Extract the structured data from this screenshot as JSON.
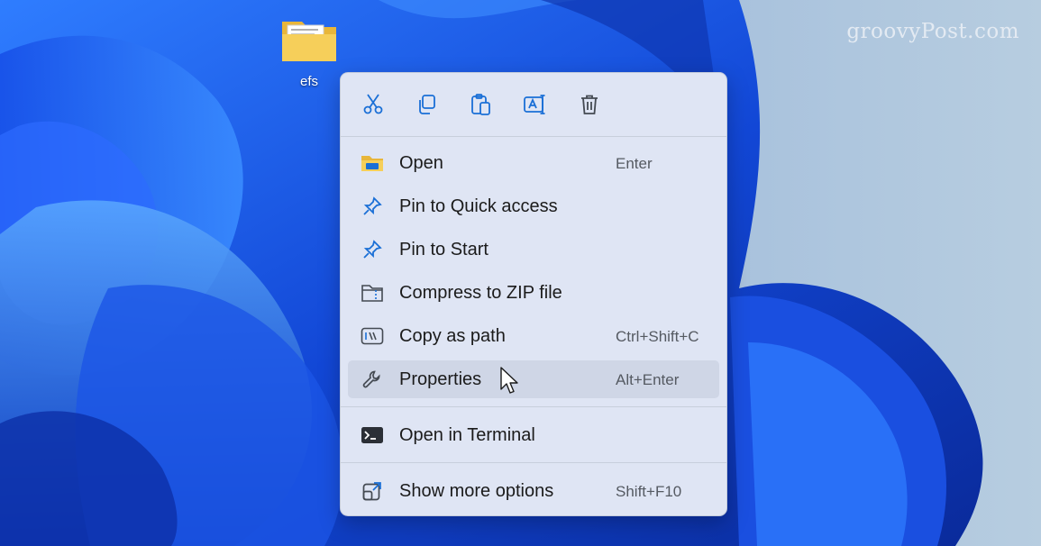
{
  "watermark": "groovyPost.com",
  "desktop": {
    "icon": {
      "label": "efs",
      "icon": "folder-icon"
    }
  },
  "context_menu": {
    "toolbar": [
      {
        "name": "cut",
        "icon": "scissors-icon"
      },
      {
        "name": "copy",
        "icon": "copy-icon"
      },
      {
        "name": "paste",
        "icon": "clipboard-icon"
      },
      {
        "name": "rename",
        "icon": "rename-icon"
      },
      {
        "name": "delete",
        "icon": "trash-icon"
      }
    ],
    "items": [
      {
        "label": "Open",
        "shortcut": "Enter",
        "icon": "folder-icon"
      },
      {
        "label": "Pin to Quick access",
        "shortcut": "",
        "icon": "pin-icon"
      },
      {
        "label": "Pin to Start",
        "shortcut": "",
        "icon": "pin-icon"
      },
      {
        "label": "Compress to ZIP file",
        "shortcut": "",
        "icon": "zip-folder-icon"
      },
      {
        "label": "Copy as path",
        "shortcut": "Ctrl+Shift+C",
        "icon": "path-icon"
      },
      {
        "label": "Properties",
        "shortcut": "Alt+Enter",
        "icon": "wrench-icon",
        "highlighted": true
      },
      {
        "label": "Open in Terminal",
        "shortcut": "",
        "icon": "terminal-icon"
      },
      {
        "label": "Show more options",
        "shortcut": "Shift+F10",
        "icon": "external-icon"
      }
    ]
  },
  "colors": {
    "accent": "#1a6fd6",
    "menu_bg": "#dfe5f4",
    "hover_bg": "#cfd6e6",
    "wallpaper_blue": "#1a4fe0"
  }
}
